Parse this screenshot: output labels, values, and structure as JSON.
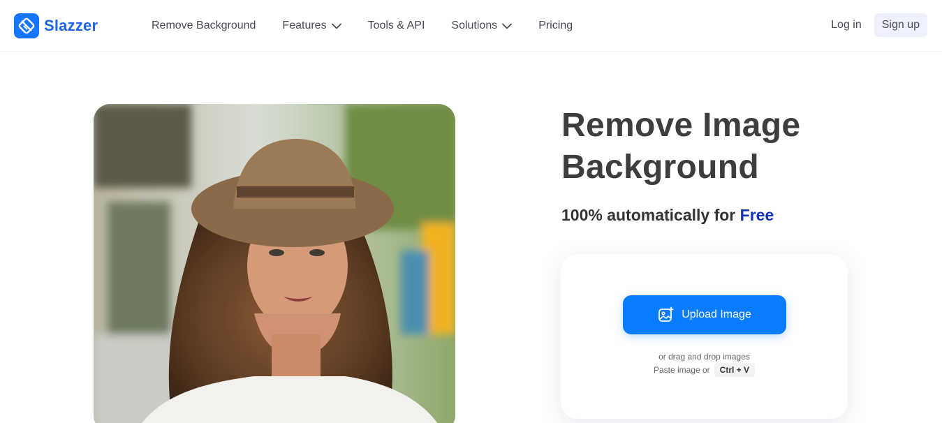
{
  "header": {
    "logo_text": "Slazzer",
    "nav": [
      {
        "label": "Remove Background",
        "has_dropdown": false
      },
      {
        "label": "Features",
        "has_dropdown": true
      },
      {
        "label": "Tools & API",
        "has_dropdown": false
      },
      {
        "label": "Solutions",
        "has_dropdown": true
      },
      {
        "label": "Pricing",
        "has_dropdown": false
      }
    ],
    "login_label": "Log in",
    "signup_label": "Sign up"
  },
  "hero": {
    "title": "Remove Image Background",
    "subtitle_prefix": "100% automatically for",
    "subtitle_highlight": "Free"
  },
  "upload": {
    "button_label": "Upload Image",
    "drag_text": "or drag and drop images",
    "paste_text": "Paste image or",
    "shortcut": "Ctrl + V"
  },
  "colors": {
    "brand": "#1676ff",
    "logo_text": "#1d64e9",
    "upload_button": "#0a7dff",
    "free_highlight": "#1432b4"
  }
}
